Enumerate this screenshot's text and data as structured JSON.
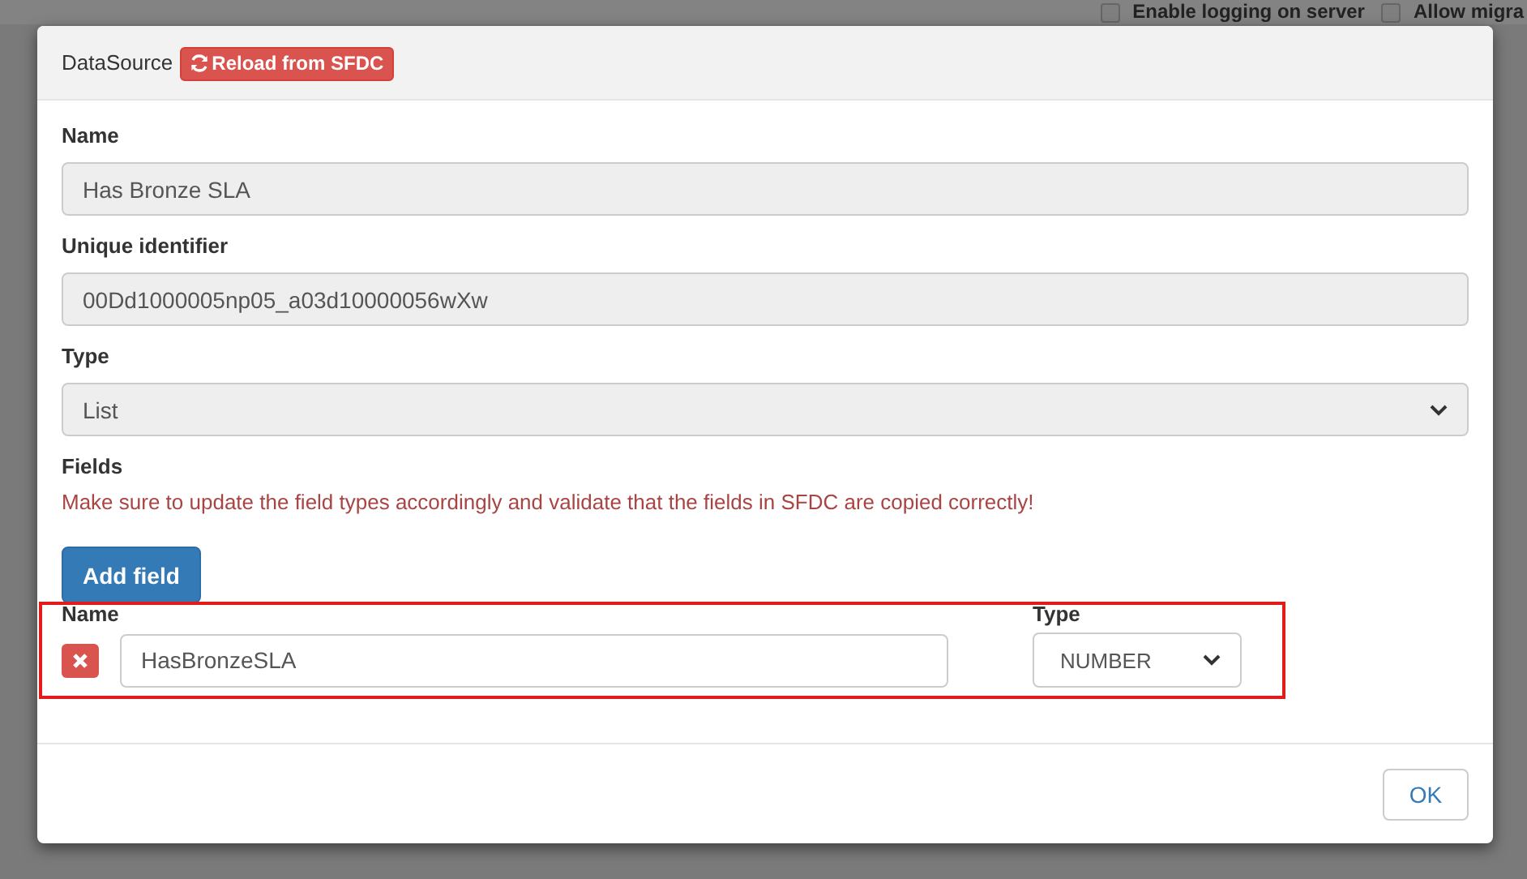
{
  "background": {
    "options": [
      {
        "label": "Enable logging on server",
        "checked": false
      },
      {
        "label": "Allow migra",
        "checked": false
      }
    ]
  },
  "dialog": {
    "title": "DataSource",
    "reload_button": "Reload from SFDC",
    "groups": [
      {
        "label": "Name",
        "kind": "input",
        "value": "Has Bronze SLA"
      },
      {
        "label": "Unique identifier",
        "kind": "input",
        "value": "00Dd1000005np05_a03d10000056wXw"
      },
      {
        "label": "Type",
        "kind": "select",
        "value": "List"
      }
    ],
    "fields_label": "Fields",
    "warning": "Make sure to update the field types accordingly and validate that the fields in SFDC are copied correctly!",
    "add_button": "Add field",
    "columns": [
      "Name",
      "Type"
    ],
    "rows": [
      {
        "name": "HasBronzeSLA",
        "type": "NUMBER",
        "highlighted": true
      }
    ],
    "ok_button": "OK"
  }
}
